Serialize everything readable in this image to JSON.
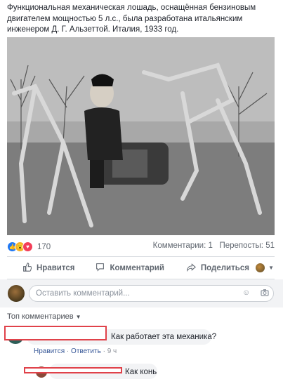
{
  "post": {
    "text": "Функциональная механическая лошадь, оснащённая бензиновым двигателем мощностью 5 л.с., была разработана итальянским инженером Д. Г. Альзеттой. Италия, 1933 год."
  },
  "stats": {
    "reaction_count": "170",
    "comments": "Комментарии: 1",
    "shares": "Перепосты: 51"
  },
  "actions": {
    "like": "Нравится",
    "comment": "Комментарий",
    "share": "Поделиться"
  },
  "composer": {
    "placeholder": "Оставить комментарий..."
  },
  "sort": {
    "label": "Топ комментариев"
  },
  "comments": [
    {
      "text": "Как работает эта механика?",
      "like": "Нравится",
      "reply": "Ответить",
      "time": "9 ч"
    },
    {
      "text": "Как конь"
    }
  ]
}
